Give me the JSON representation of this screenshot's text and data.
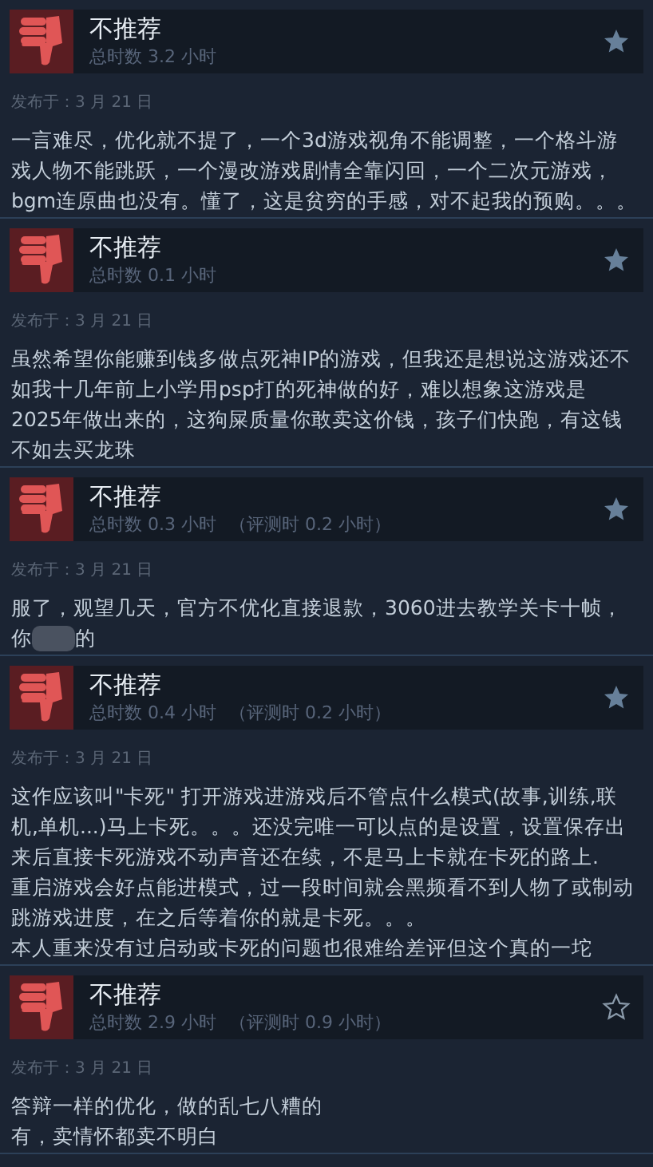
{
  "reviews": [
    {
      "verdict": "不推荐",
      "hours": "总时数 3.2 小时",
      "starred": true,
      "posted": "发布于：3 月 21 日",
      "lines": [
        [
          {
            "kind": "text",
            "text": "一言难尽，优化就不提了，一个3d游戏视角不能调整，一个格斗游"
          }
        ],
        [
          {
            "kind": "text",
            "text": "戏人物不能跳跃，一个漫改游戏剧情全靠闪回，一个二次元游戏，"
          }
        ],
        [
          {
            "kind": "text",
            "text": "bgm连原曲也没有。懂了，这是贫穷的手感，对不起我的预购。。。"
          }
        ]
      ]
    },
    {
      "verdict": "不推荐",
      "hours": "总时数 0.1 小时",
      "starred": true,
      "posted": "发布于：3 月 21 日",
      "lines": [
        [
          {
            "kind": "text",
            "text": "虽然希望你能赚到钱多做点死神IP的游戏，但我还是想说这游戏还不"
          }
        ],
        [
          {
            "kind": "text",
            "text": "如我十几年前上小学用psp打的死神做的好，难以想象这游戏是"
          }
        ],
        [
          {
            "kind": "text",
            "text": "2025年做出来的，这狗屎质量你敢卖这价钱，孩子们快跑，有这钱"
          }
        ],
        [
          {
            "kind": "text",
            "text": "不如去买龙珠"
          }
        ]
      ]
    },
    {
      "verdict": "不推荐",
      "hours": "总时数 0.3 小时",
      "review_time": "（评测时 0.2 小时）",
      "starred": true,
      "posted": "发布于：3 月 21 日",
      "lines": [
        [
          {
            "kind": "text",
            "text": "服了，观望几天，官方不优化直接退款，3060进去教学关卡十帧，"
          }
        ],
        [
          {
            "kind": "text",
            "text": "你"
          },
          {
            "kind": "blur"
          },
          {
            "kind": "text",
            "text": "的"
          }
        ]
      ]
    },
    {
      "verdict": "不推荐",
      "hours": "总时数 0.4 小时",
      "review_time": "（评测时 0.2 小时）",
      "starred": true,
      "posted": "发布于：3 月 21 日",
      "lines": [
        [
          {
            "kind": "text",
            "text": "这作应该叫\"卡死\" 打开游戏进游戏后不管点什么模式(故事,训练,联"
          }
        ],
        [
          {
            "kind": "text",
            "text": "机,单机...)马上卡死。。。还没完唯一可以点的是设置，设置保存出"
          }
        ],
        [
          {
            "kind": "text",
            "text": "来后直接卡死游戏不动声音还在续，不是马上卡就在卡死的路上."
          }
        ],
        [
          {
            "kind": "text",
            "text": "重启游戏会好点能进模式，过一段时间就会黑频看不到人物了或制动"
          }
        ],
        [
          {
            "kind": "text",
            "text": "跳游戏进度，在之后等着你的就是卡死。。。"
          }
        ],
        [
          {
            "kind": "text",
            "text": "本人重来没有过启动或卡死的问题也很难给差评但这个真的一坨"
          }
        ]
      ]
    },
    {
      "verdict": "不推荐",
      "hours": "总时数 2.9 小时",
      "review_time": "（评测时 0.9 小时）",
      "starred": false,
      "posted": "发布于：3 月 21 日",
      "lines": [
        [
          {
            "kind": "text",
            "text": "答辩一样的优化，做的乱七八糟的"
          }
        ],
        [
          {
            "kind": "text",
            "text": "有，卖情怀都卖不明白"
          }
        ]
      ]
    }
  ]
}
